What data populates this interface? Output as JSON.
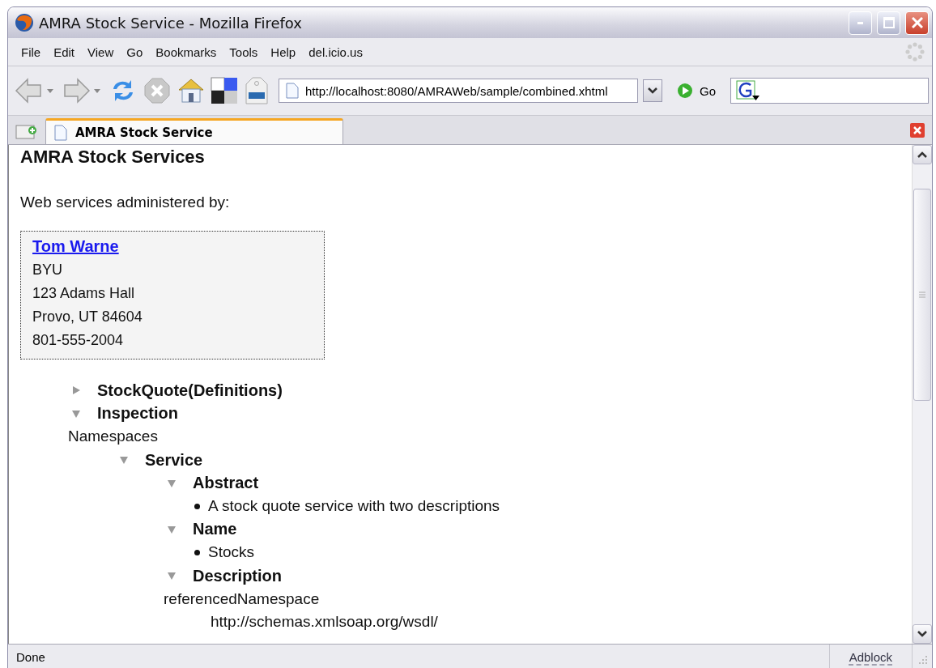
{
  "window": {
    "title": "AMRA Stock Service - Mozilla Firefox"
  },
  "menu": [
    "File",
    "Edit",
    "View",
    "Go",
    "Bookmarks",
    "Tools",
    "Help",
    "del.icio.us"
  ],
  "address": {
    "value": "http://localhost:8080/AMRAWeb/sample/combined.xhtml"
  },
  "go_label": "Go",
  "tabs": [
    {
      "label": "AMRA Stock Service",
      "selected": true
    }
  ],
  "page": {
    "heading": "AMRA Stock Services",
    "intro": "Web services administered by:",
    "contact": {
      "name": "Tom Warne",
      "lines": [
        "BYU",
        "123 Adams Hall",
        "Provo, UT 84604",
        "801-555-2004"
      ]
    },
    "tree": [
      {
        "kind": "node",
        "label": "StockQuote(Definitions)",
        "expanded": false
      },
      {
        "kind": "node",
        "label": "Inspection",
        "expanded": true,
        "children": [
          {
            "kind": "text",
            "label": "Namespaces"
          },
          {
            "kind": "node",
            "label": "Service",
            "expanded": true,
            "children": [
              {
                "kind": "node",
                "label": "Abstract",
                "expanded": true,
                "children": [
                  {
                    "kind": "bullet",
                    "label": "A stock quote service with two descriptions"
                  }
                ]
              },
              {
                "kind": "node",
                "label": "Name",
                "expanded": true,
                "children": [
                  {
                    "kind": "bullet",
                    "label": "Stocks"
                  }
                ]
              },
              {
                "kind": "node",
                "label": "Description",
                "expanded": true,
                "children": [
                  {
                    "kind": "text",
                    "label": "referencedNamespace"
                  },
                  {
                    "kind": "value",
                    "label": "http://schemas.xmlsoap.org/wsdl/"
                  }
                ]
              }
            ]
          }
        ]
      }
    ]
  },
  "status_bar": {
    "text": "Done",
    "adblock": "Adblock"
  }
}
